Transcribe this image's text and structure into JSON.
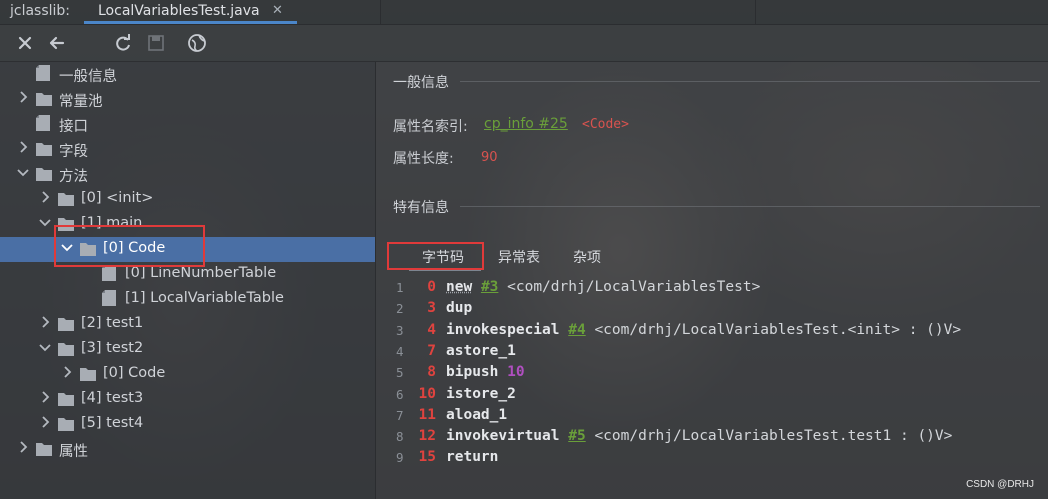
{
  "tabs": {
    "app_label": "jclasslib:",
    "file_label": "LocalVariablesTest.java",
    "close_glyph": "✕"
  },
  "toolbar": {
    "buttons": [
      "close-icon",
      "back-icon",
      "refresh-icon",
      "save-icon",
      "browser-icon"
    ]
  },
  "tree": {
    "items": [
      {
        "label": "一般信息",
        "kind": "file"
      },
      {
        "label": "常量池",
        "kind": "folder",
        "expanded": false
      },
      {
        "label": "接口",
        "kind": "file"
      },
      {
        "label": "字段",
        "kind": "folder",
        "expanded": false
      },
      {
        "label": "方法",
        "kind": "folder",
        "expanded": true
      },
      {
        "label": "[0] <init>",
        "kind": "folder",
        "expanded": false
      },
      {
        "label": "[1] main",
        "kind": "folder",
        "expanded": true
      },
      {
        "label": "[0] Code",
        "kind": "folder",
        "expanded": true,
        "selected": true
      },
      {
        "label": "[0] LineNumberTable",
        "kind": "file"
      },
      {
        "label": "[1] LocalVariableTable",
        "kind": "file"
      },
      {
        "label": "[2] test1",
        "kind": "folder",
        "expanded": false
      },
      {
        "label": "[3] test2",
        "kind": "folder",
        "expanded": true
      },
      {
        "label": "[0] Code",
        "kind": "folder",
        "expanded": false
      },
      {
        "label": "[4] test3",
        "kind": "folder",
        "expanded": false
      },
      {
        "label": "[5] test4",
        "kind": "folder",
        "expanded": false
      },
      {
        "label": "属性",
        "kind": "folder",
        "expanded": false
      }
    ]
  },
  "general": {
    "title": "一般信息",
    "name_index_label": "属性名索引:",
    "name_index_link": "cp_info #25",
    "name_index_value": "<Code>",
    "length_label": "属性长度:",
    "length_value": "90"
  },
  "specific": {
    "title": "特有信息",
    "tabs": [
      "字节码",
      "异常表",
      "杂项"
    ],
    "active_tab": "字节码"
  },
  "bytecode": [
    {
      "line": "1",
      "offset": "0",
      "op": "new",
      "ref": "#3",
      "comment": "<com/drhj/LocalVariablesTest>"
    },
    {
      "line": "2",
      "offset": "3",
      "op": "dup"
    },
    {
      "line": "3",
      "offset": "4",
      "op": "invokespecial",
      "ref": "#4",
      "comment": "<com/drhj/LocalVariablesTest.<init> : ()V>"
    },
    {
      "line": "4",
      "offset": "7",
      "op": "astore_1"
    },
    {
      "line": "5",
      "offset": "8",
      "op": "bipush",
      "imm": "10"
    },
    {
      "line": "6",
      "offset": "10",
      "op": "istore_2"
    },
    {
      "line": "7",
      "offset": "11",
      "op": "aload_1"
    },
    {
      "line": "8",
      "offset": "12",
      "op": "invokevirtual",
      "ref": "#5",
      "comment": "<com/drhj/LocalVariablesTest.test1 : ()V>"
    },
    {
      "line": "9",
      "offset": "15",
      "op": "return"
    }
  ],
  "watermark": "CSDN @DRHJ",
  "colors": {
    "accent": "#4b86c9",
    "selection": "#4a6fa5",
    "highlight_box": "#e03a3a",
    "offset": "#e0433f",
    "link": "#6a9f3a",
    "immediate": "#b04fc0"
  }
}
